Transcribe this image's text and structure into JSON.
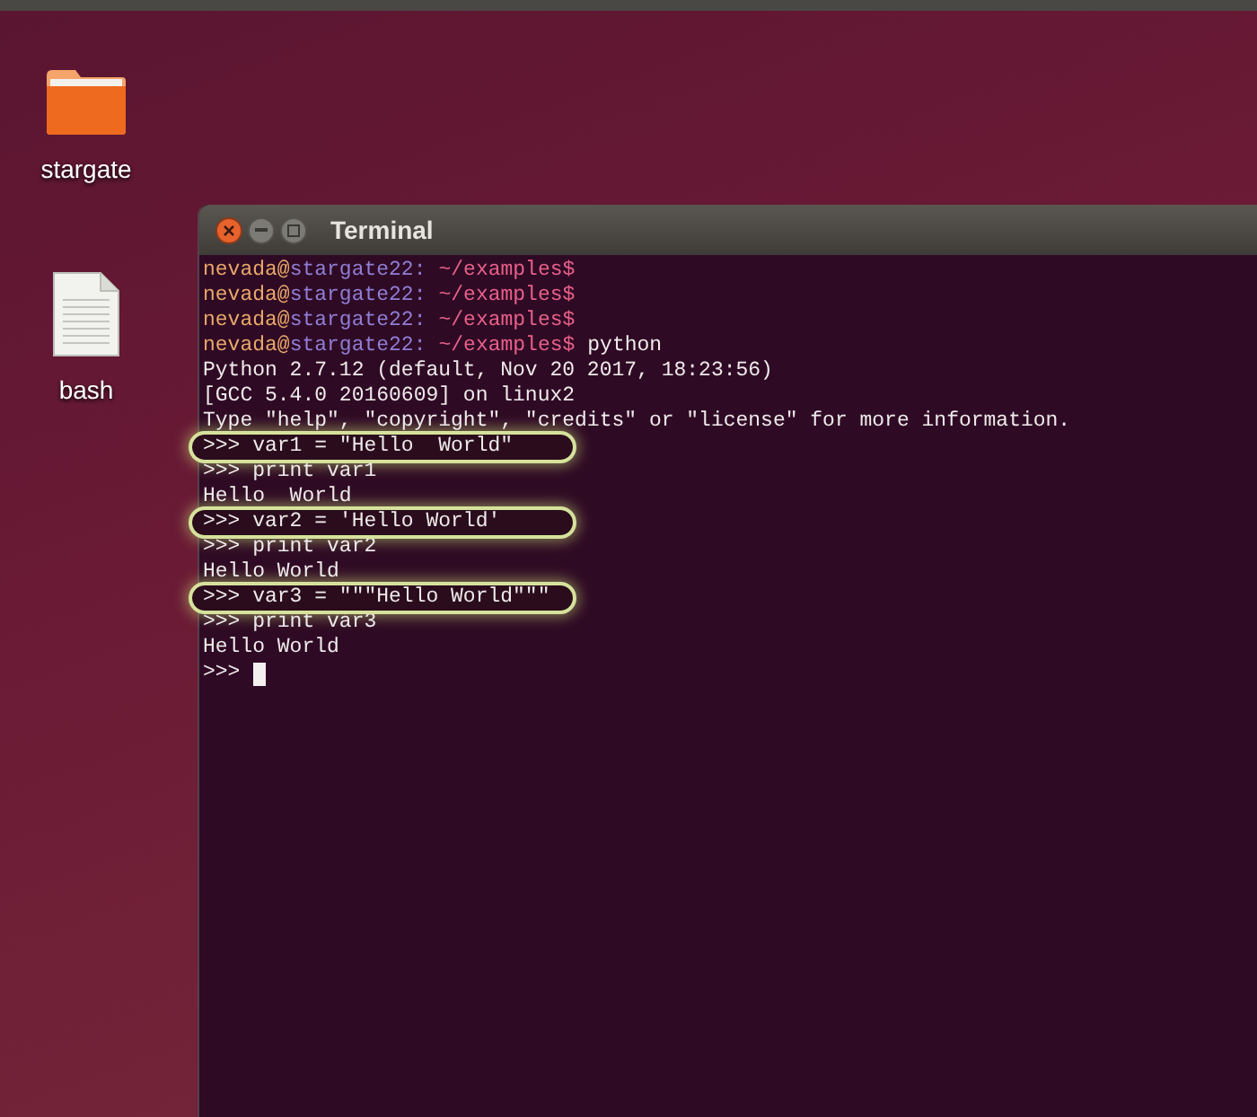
{
  "desktop_icons": [
    {
      "kind": "folder",
      "label": "stargate"
    },
    {
      "kind": "file",
      "label": "bash"
    }
  ],
  "window": {
    "title": "Terminal"
  },
  "terminal": {
    "lines": [
      {
        "kind": "prompt",
        "user": "nevada@",
        "host": "stargate22:",
        "path": "~/examples$",
        "highlighted": false
      },
      {
        "kind": "prompt",
        "user": "nevada@",
        "host": "stargate22:",
        "path": "~/examples$",
        "highlighted": false
      },
      {
        "kind": "prompt",
        "user": "nevada@",
        "host": "stargate22:",
        "path": "~/examples$",
        "highlighted": false
      },
      {
        "kind": "prompt",
        "user": "nevada@",
        "host": "stargate22:",
        "path": "~/examples$",
        "command": "python",
        "highlighted": false
      },
      {
        "kind": "output",
        "text": "Python 2.7.12 (default, Nov 20 2017, 18:23:56)",
        "highlighted": false
      },
      {
        "kind": "output",
        "text": "[GCC 5.4.0 20160609] on linux2",
        "highlighted": false
      },
      {
        "kind": "output",
        "text": "Type \"help\", \"copyright\", \"credits\" or \"license\" for more information.",
        "highlighted": false
      },
      {
        "kind": "output",
        "text": ">>> var1 = \"Hello  World\"",
        "highlighted": true
      },
      {
        "kind": "output",
        "text": ">>> print var1",
        "highlighted": false
      },
      {
        "kind": "output",
        "text": "Hello  World",
        "highlighted": false
      },
      {
        "kind": "output",
        "text": ">>> var2 = 'Hello World'",
        "highlighted": true
      },
      {
        "kind": "output",
        "text": ">>> print var2",
        "highlighted": false
      },
      {
        "kind": "output",
        "text": "Hello World",
        "highlighted": false
      },
      {
        "kind": "output",
        "text": ">>> var3 = \"\"\"Hello World\"\"\"",
        "highlighted": true
      },
      {
        "kind": "output",
        "text": ">>> print var3",
        "highlighted": false
      },
      {
        "kind": "output",
        "text": "Hello World",
        "highlighted": false
      },
      {
        "kind": "input",
        "text": ">>>",
        "cursor": true,
        "highlighted": false
      }
    ]
  }
}
